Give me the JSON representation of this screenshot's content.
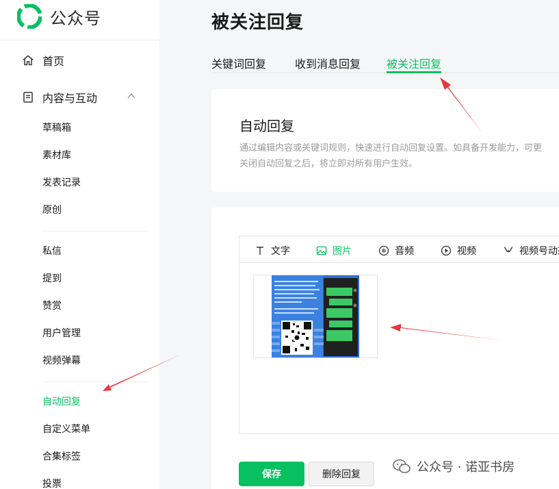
{
  "brand": {
    "name": "公众号",
    "accent": "#07c160"
  },
  "sidebar": {
    "home": "首页",
    "content_group": "内容与互动",
    "content_items": [
      "草稿箱",
      "素材库",
      "发表记录",
      "原创"
    ],
    "interact_items": [
      "私信",
      "提到",
      "赞赏",
      "用户管理",
      "视频弹幕"
    ],
    "tools_items": [
      "自动回复",
      "自定义菜单",
      "合集标签",
      "投票"
    ],
    "active_item": "自动回复"
  },
  "page": {
    "title": "被关注回复"
  },
  "tabs": [
    {
      "label": "关键词回复",
      "active": false
    },
    {
      "label": "收到消息回复",
      "active": false
    },
    {
      "label": "被关注回复",
      "active": true
    }
  ],
  "intro": {
    "title": "自动回复",
    "desc_line1": "通过编辑内容或关键词规则，快速进行自动回复设置。如具备开发能力，可更",
    "desc_line2": "关闭自动回复之后，将立即对所有用户生效。"
  },
  "editor": {
    "toolbar": [
      {
        "label": "文字",
        "icon": "text-icon",
        "active": false
      },
      {
        "label": "图片",
        "icon": "image-icon",
        "active": true
      },
      {
        "label": "音频",
        "icon": "audio-icon",
        "active": false
      },
      {
        "label": "视频",
        "icon": "video-icon",
        "active": false
      },
      {
        "label": "视频号动态",
        "icon": "channels-icon",
        "active": false
      }
    ]
  },
  "actions": {
    "save": "保存",
    "delete": "删除回复"
  },
  "watermark": {
    "text": "公众号 · 诺亚书房"
  }
}
